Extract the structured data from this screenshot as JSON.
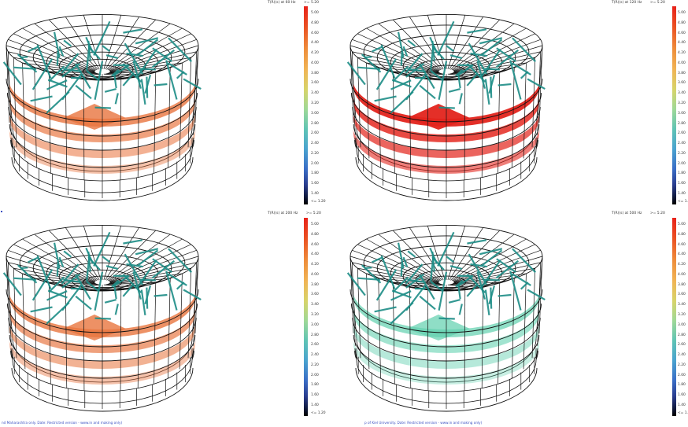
{
  "panels": [
    {
      "header_left": "T(R)(s) at 60 Hz",
      "header_right": ">= 5.20",
      "highlight": "#e9743e",
      "highlight_level": "medium"
    },
    {
      "header_left": "T(R)(s) at 120 Hz",
      "header_right": ">= 5.20",
      "highlight": "#e3241c",
      "highlight_level": "high"
    },
    {
      "header_left": "T(R)(s) at 200 Hz",
      "header_right": ">= 5.20",
      "highlight": "#e8753f",
      "highlight_level": "medium"
    },
    {
      "header_left": "T(R)(s) at 500 Hz",
      "header_right": ">= 5.20",
      "highlight": "#5fd0ae",
      "highlight_level": "low"
    }
  ],
  "scale_ticks": [
    "5.00",
    "4.80",
    "4.60",
    "4.40",
    "4.20",
    "4.00",
    "3.80",
    "3.60",
    "3.40",
    "3.20",
    "3.00",
    "2.80",
    "2.60",
    "2.40",
    "2.20",
    "2.00",
    "1.80",
    "1.60",
    "1.40"
  ],
  "scale_min_label": "<= 1.20",
  "footers": {
    "left": "nd Maharashtra only. Date: Restricted version - www.in and making only)",
    "right": "p of Kiel University. Date: Restricted version - www.in and making only)"
  },
  "colors": {
    "frame": "#111111",
    "beam": "#1e8d87",
    "ring_fill": "#ffffff",
    "background": "#ffffff"
  }
}
